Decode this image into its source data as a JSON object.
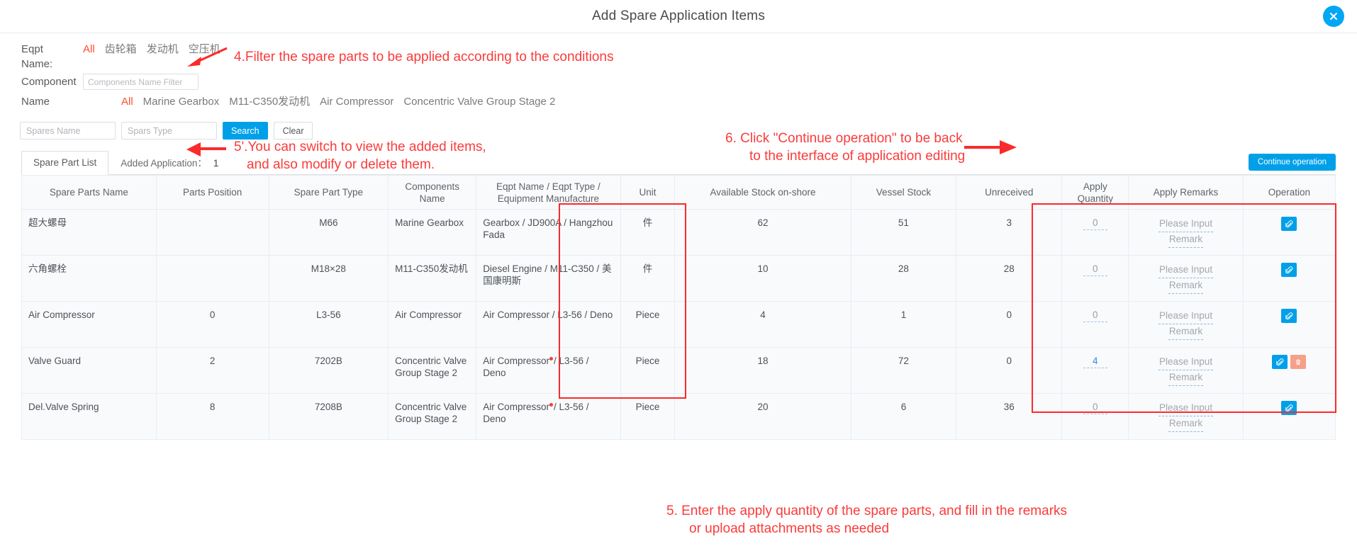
{
  "dialog": {
    "title": "Add Spare Application Items",
    "close_icon": "close-icon"
  },
  "filters": {
    "eqpt_name_label": "Eqpt Name:",
    "eqpt_chips": [
      {
        "label": "All",
        "active": true
      },
      {
        "label": "齿轮箱",
        "active": false
      },
      {
        "label": "发动机",
        "active": false
      },
      {
        "label": "空压机",
        "active": false
      }
    ],
    "component_label": "Component",
    "component_placeholder": "Components Name Filter",
    "component_value": "",
    "name_label": "Name",
    "name_chips": [
      {
        "label": "All",
        "active": true
      },
      {
        "label": "Marine Gearbox",
        "active": false
      },
      {
        "label": "M11-C350发动机",
        "active": false
      },
      {
        "label": "Air Compressor",
        "active": false
      },
      {
        "label": "Concentric Valve Group Stage 2",
        "active": false
      }
    ]
  },
  "search": {
    "spares_name_placeholder": "Spares Name",
    "spares_name_value": "",
    "spars_type_placeholder": "Spars Type",
    "spars_type_value": "",
    "search_label": "Search",
    "clear_label": "Clear"
  },
  "tabs": {
    "spare_part_list": "Spare Part List",
    "added_application": "Added Application：",
    "added_count": "1",
    "continue_label": "Continue operation"
  },
  "table": {
    "columns": [
      "Spare Parts Name",
      "Parts Position",
      "Spare Part Type",
      "Components Name",
      "Eqpt Name / Eqpt Type / Equipment Manufacture",
      "Unit",
      "Available Stock on-shore",
      "Vessel Stock",
      "Unreceived",
      "Apply Quantity",
      "Apply Remarks",
      "Operation"
    ],
    "remark_placeholder_line1": "Please Input",
    "remark_placeholder_line2": "Remark",
    "rows": [
      {
        "spare_parts_name": "超大螺母",
        "parts_position": "",
        "spare_part_type": "M66",
        "components_name": "Marine Gearbox",
        "eqpt": "Gearbox / JD900A / Hangzhou Fada",
        "eqpt_flag": false,
        "unit": "件",
        "available_stock": "62",
        "vessel_stock": "51",
        "unreceived": "3",
        "apply_quantity": "0",
        "qty_filled": false,
        "has_delete": false
      },
      {
        "spare_parts_name": "六角螺栓",
        "parts_position": "",
        "spare_part_type": "M18×28",
        "components_name": "M11-C350发动机",
        "eqpt": "Diesel Engine / M11-C350 / 美国康明斯",
        "eqpt_flag": false,
        "unit": "件",
        "available_stock": "10",
        "vessel_stock": "28",
        "unreceived": "28",
        "apply_quantity": "0",
        "qty_filled": false,
        "has_delete": false
      },
      {
        "spare_parts_name": "Air Compressor",
        "parts_position": "0",
        "spare_part_type": "L3-56",
        "components_name": "Air Compressor",
        "eqpt": "Air Compressor / L3-56 / Deno",
        "eqpt_flag": false,
        "unit": "Piece",
        "available_stock": "4",
        "vessel_stock": "1",
        "unreceived": "0",
        "apply_quantity": "0",
        "qty_filled": false,
        "has_delete": false
      },
      {
        "spare_parts_name": "Valve Guard",
        "parts_position": "2",
        "spare_part_type": "7202B",
        "components_name": "Concentric Valve Group Stage 2",
        "eqpt": "Air Compressor / L3-56 / Deno",
        "eqpt_flag": true,
        "unit": "Piece",
        "available_stock": "18",
        "vessel_stock": "72",
        "unreceived": "0",
        "apply_quantity": "4",
        "qty_filled": true,
        "has_delete": true
      },
      {
        "spare_parts_name": "Del.Valve Spring",
        "parts_position": "8",
        "spare_part_type": "7208B",
        "components_name": "Concentric Valve Group Stage 2",
        "eqpt": "Air Compressor / L3-56 / Deno",
        "eqpt_flag": true,
        "unit": "Piece",
        "available_stock": "20",
        "vessel_stock": "6",
        "unreceived": "36",
        "apply_quantity": "0",
        "qty_filled": false,
        "has_delete": false
      }
    ]
  },
  "annotations": {
    "a4": "4.Filter the spare parts to be applied according to the conditions",
    "a5prime_l1": "5'.You can switch to view the added items,",
    "a5prime_l2": "and also modify or delete them.",
    "a6_l1": "6. Click \"Continue operation\" to be back",
    "a6_l2": "to the interface of application editing",
    "a5_l1": "5. Enter the apply quantity of the spare parts, and fill in the remarks",
    "a5_l2": "or upload attachments as needed"
  },
  "colors": {
    "accent": "#00a0e9",
    "annotation_red": "#fb3b3b",
    "active_chip": "#ff4d2e",
    "delete_btn": "#f5a08a"
  }
}
